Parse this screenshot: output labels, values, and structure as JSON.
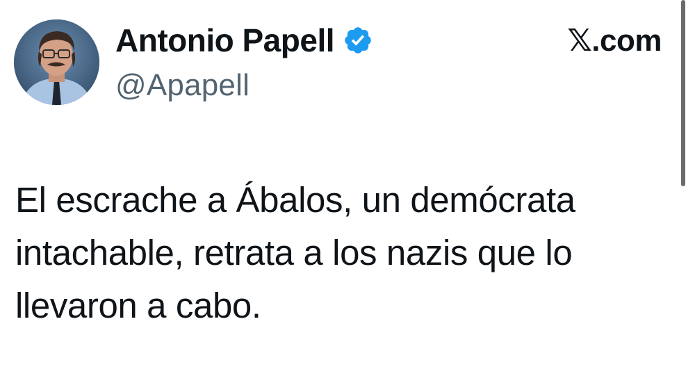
{
  "tweet": {
    "author": {
      "display_name": "Antonio Papell",
      "handle": "@Apapell",
      "verified": true,
      "avatar_icon": "profile-photo"
    },
    "source": "𝕏.com",
    "text": "El escrache a Ábalos, un demócrata intachable, retrata a los nazis que lo llevaron a cabo."
  },
  "colors": {
    "text_primary": "#0f1419",
    "text_secondary": "#536471",
    "verified_blue": "#1d9bf0",
    "background": "#ffffff"
  }
}
